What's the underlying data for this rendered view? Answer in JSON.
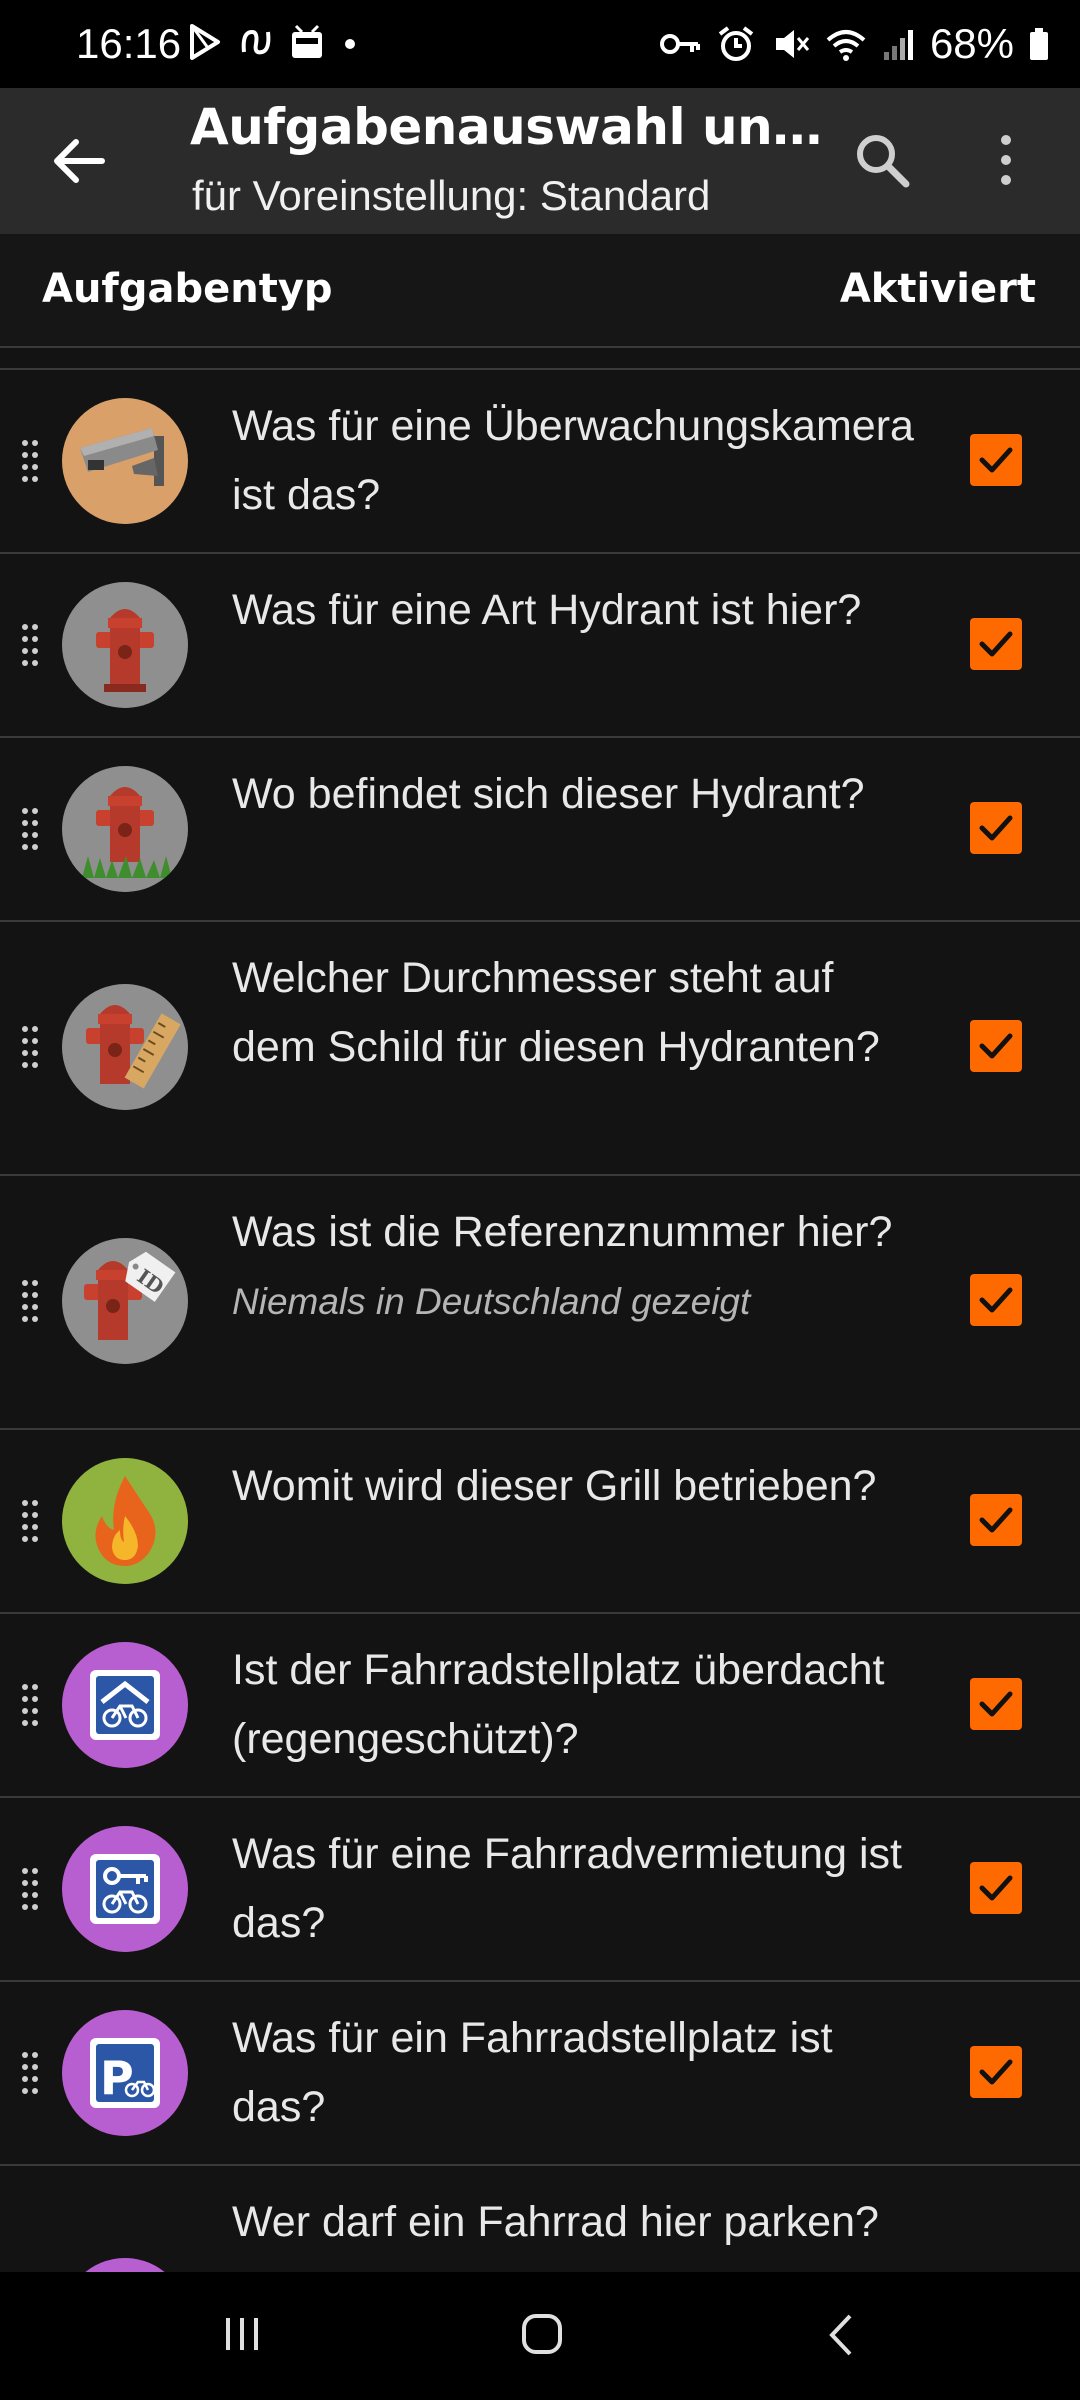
{
  "status_bar": {
    "time": "16:16",
    "battery": "68%",
    "left_icons": [
      "play-store-icon",
      "notification-icon",
      "app-icon",
      "dot-icon"
    ],
    "right_icons": [
      "key-icon",
      "alarm-icon",
      "mute-icon",
      "wifi-icon",
      "signal-icon",
      "battery-icon"
    ]
  },
  "app_bar": {
    "title": "Aufgabenauswahl und -rei…",
    "subtitle": "für Voreinstellung: Standard"
  },
  "column_header": {
    "type_label": "Aufgabentyp",
    "enabled_label": "Aktiviert"
  },
  "colors": {
    "accent": "#ff6a00",
    "background": "#131313",
    "app_bar": "#2b2b2b"
  },
  "rows": [
    {
      "icon": "surveillance-camera-icon",
      "text": "Was für eine Überwachungskamera ist das?",
      "note": "",
      "enabled": true
    },
    {
      "icon": "fire-hydrant-icon",
      "text": "Was für eine Art Hydrant ist hier?",
      "note": "",
      "enabled": true
    },
    {
      "icon": "fire-hydrant-grass-icon",
      "text": "Wo befindet sich dieser Hydrant?",
      "note": "",
      "enabled": true
    },
    {
      "icon": "fire-hydrant-diameter-icon",
      "text": "Welcher Durchmesser steht auf dem Schild für diesen Hydranten?",
      "note": "",
      "enabled": true
    },
    {
      "icon": "fire-hydrant-id-icon",
      "text": "Was ist die Referenznummer hier?",
      "note": "Niemals in Deutschland gezeigt",
      "enabled": true
    },
    {
      "icon": "fire-icon",
      "text": "Womit wird dieser Grill betrieben?",
      "note": "",
      "enabled": true
    },
    {
      "icon": "bicycle-parking-roof-icon",
      "text": "Ist der Fahrradstellplatz überdacht (regengeschützt)?",
      "note": "",
      "enabled": true
    },
    {
      "icon": "bicycle-rental-icon",
      "text": "Was für eine Fahrradvermietung ist das?",
      "note": "",
      "enabled": true
    },
    {
      "icon": "bicycle-parking-icon",
      "text": "Was für ein Fahrradstellplatz ist das?",
      "note": "",
      "enabled": true
    },
    {
      "icon": "bicycle-parking-access-icon",
      "text": "Wer darf ein Fahrrad hier parken? Das Parken kann",
      "note": "",
      "enabled": true
    }
  ]
}
